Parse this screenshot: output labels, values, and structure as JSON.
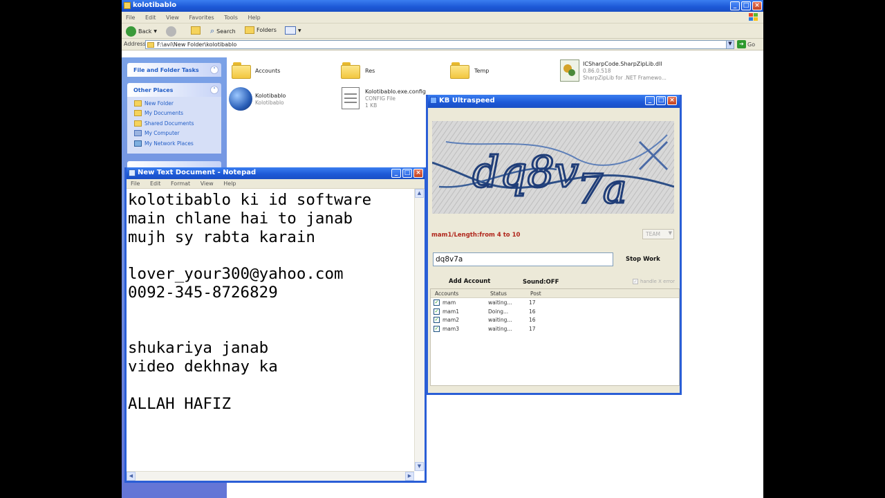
{
  "explorer": {
    "title": "kolotibablo",
    "menu": [
      "File",
      "Edit",
      "View",
      "Favorites",
      "Tools",
      "Help"
    ],
    "toolbar": {
      "back": "Back",
      "search": "Search",
      "folders": "Folders"
    },
    "address_label": "Address",
    "address_value": "F:\\avi\\New Folder\\kolotibablo",
    "go_label": "Go",
    "tasks": {
      "file_folder_tasks": "File and Folder Tasks",
      "other_places": "Other Places",
      "places": [
        "New Folder",
        "My Documents",
        "Shared Documents",
        "My Computer",
        "My Network Places"
      ]
    },
    "files": [
      {
        "name": "Accounts"
      },
      {
        "name": "Res"
      },
      {
        "name": "Temp"
      },
      {
        "name": "ICSharpCode.SharpZipLib.dll",
        "line2": "0.86.0.518",
        "line3": "SharpZipLib for .NET Framewo..."
      },
      {
        "name": "Kolotibablo",
        "line2": "Kolotibablo"
      },
      {
        "name": "Kolotibablo.exe.config",
        "line2": "CONFIG File",
        "line3": "1 KB"
      }
    ]
  },
  "notepad": {
    "title": "New Text Document - Notepad",
    "menu": [
      "File",
      "Edit",
      "Format",
      "View",
      "Help"
    ],
    "lines": [
      "kolotibablo ki id software",
      "main chlane hai to janab",
      "mujh sy rabta karain",
      "",
      "lover_your300@yahoo.com",
      "0092-345-8726829",
      "",
      "",
      "shukariya janab",
      "video dekhnay ka",
      "",
      "ALLAH HAFIZ"
    ]
  },
  "kb": {
    "title": "KB Ultraspeed",
    "captcha_label": "mam1/Length:from 4 to 10",
    "team": "TEAM",
    "captcha_input": "dq8v7a",
    "stop_work": "Stop Work",
    "add_account": "Add Account",
    "sound": "Sound:OFF",
    "handle_error": "handle X error",
    "columns": [
      "Accounts",
      "Status",
      "Post"
    ],
    "accounts": [
      {
        "name": "mam",
        "status": "waiting...",
        "post": "17"
      },
      {
        "name": "mam1",
        "status": "Doing...",
        "post": "16"
      },
      {
        "name": "mam2",
        "status": "waiting...",
        "post": "16"
      },
      {
        "name": "mam3",
        "status": "waiting...",
        "post": "17"
      }
    ]
  },
  "colors": {
    "xp_blue": "#2a5ed6",
    "task_pane": "#6f8fe0",
    "label_red": "#b0241a"
  }
}
